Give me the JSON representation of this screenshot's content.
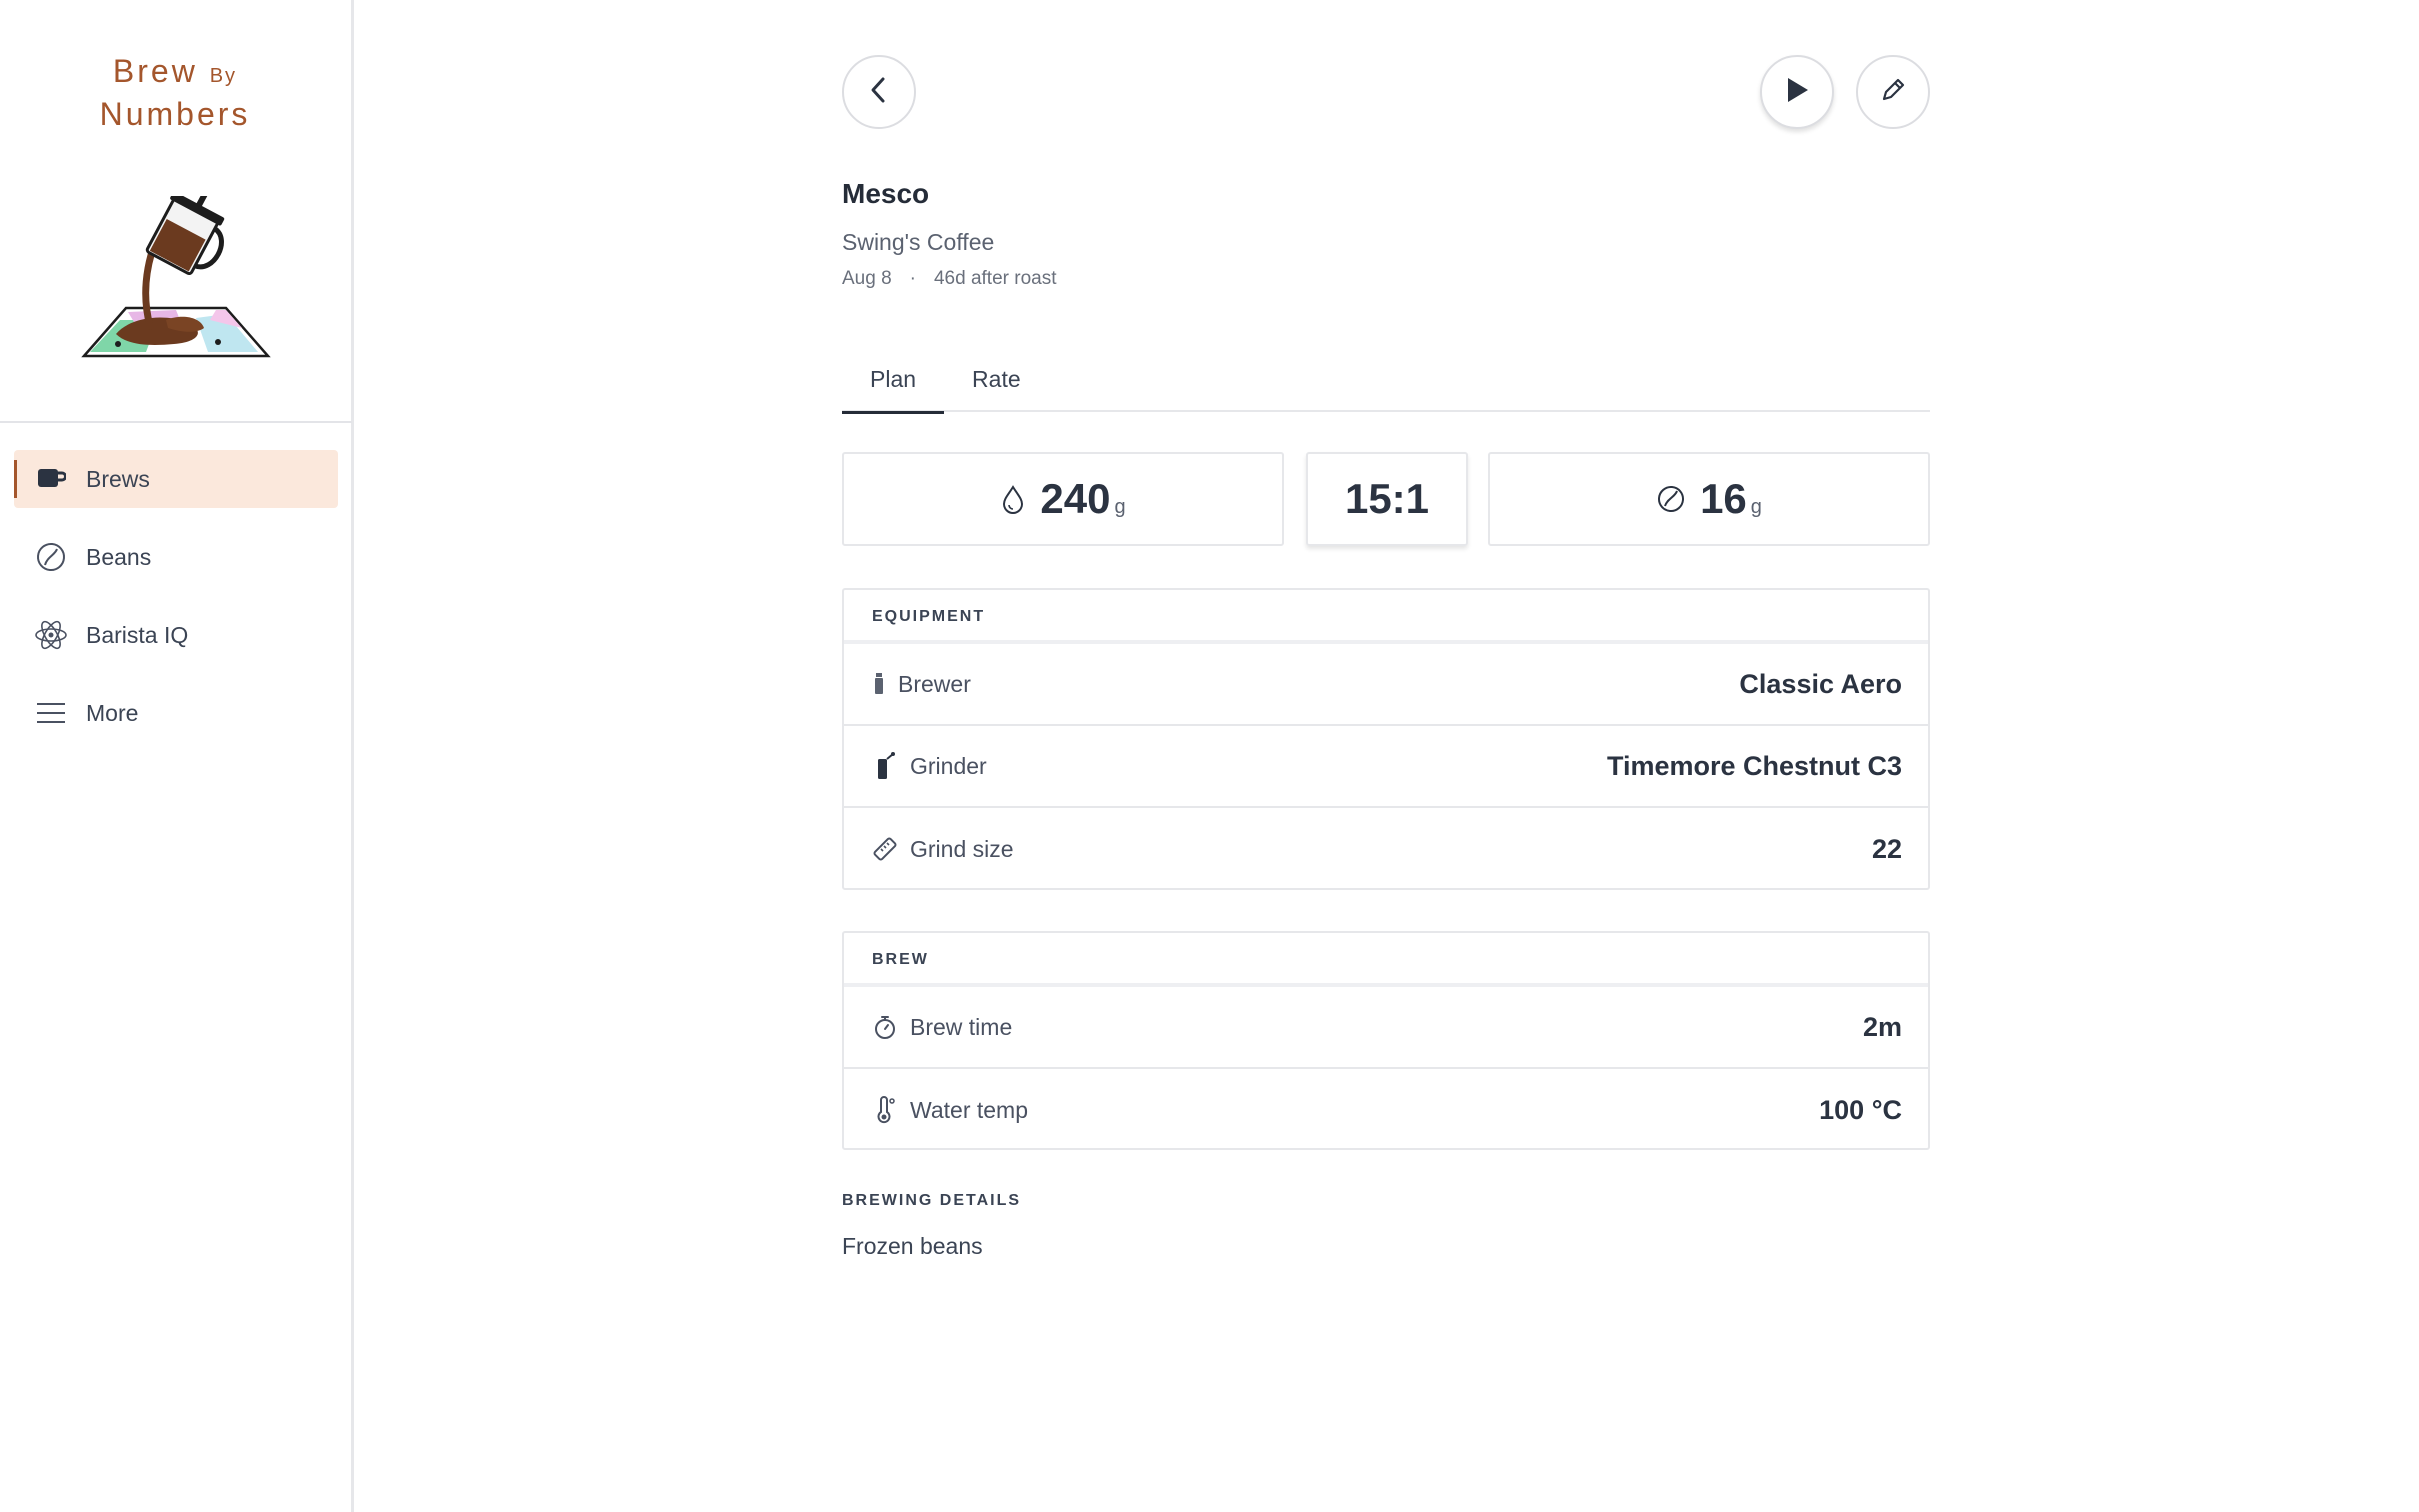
{
  "app": {
    "logo_line1": "Brew",
    "logo_by": "By",
    "logo_line2": "Numbers"
  },
  "sidebar": {
    "items": [
      {
        "label": "Brews",
        "icon": "mug-icon",
        "active": true
      },
      {
        "label": "Beans",
        "icon": "bean-icon",
        "active": false
      },
      {
        "label": "Barista IQ",
        "icon": "atom-icon",
        "active": false
      },
      {
        "label": "More",
        "icon": "menu-icon",
        "active": false
      }
    ]
  },
  "brew": {
    "title": "Mesco",
    "roaster": "Swing's Coffee",
    "date": "Aug 8",
    "separator": "·",
    "roast_age": "46d after roast"
  },
  "tabs": [
    {
      "label": "Plan",
      "active": true
    },
    {
      "label": "Rate",
      "active": false
    }
  ],
  "stats": {
    "water_value": "240",
    "water_unit": "g",
    "ratio": "15:1",
    "beans_value": "16",
    "beans_unit": "g"
  },
  "equipment": {
    "heading": "EQUIPMENT",
    "rows": [
      {
        "label": "Brewer",
        "value": "Classic Aero",
        "icon": "aeropress-icon"
      },
      {
        "label": "Grinder",
        "value": "Timemore Chestnut C3",
        "icon": "grinder-icon"
      },
      {
        "label": "Grind size",
        "value": "22",
        "icon": "ruler-icon"
      }
    ]
  },
  "brew_section": {
    "heading": "BREW",
    "rows": [
      {
        "label": "Brew time",
        "value": "2m",
        "icon": "stopwatch-icon"
      },
      {
        "label": "Water temp",
        "value": "100 °C",
        "icon": "thermometer-icon"
      }
    ]
  },
  "details": {
    "heading": "BREWING DETAILS",
    "text": "Frozen beans"
  },
  "colors": {
    "brand": "#a4562c",
    "active_bg": "#fbe8dc",
    "text": "#2b3341",
    "border": "#e6e7ea"
  }
}
